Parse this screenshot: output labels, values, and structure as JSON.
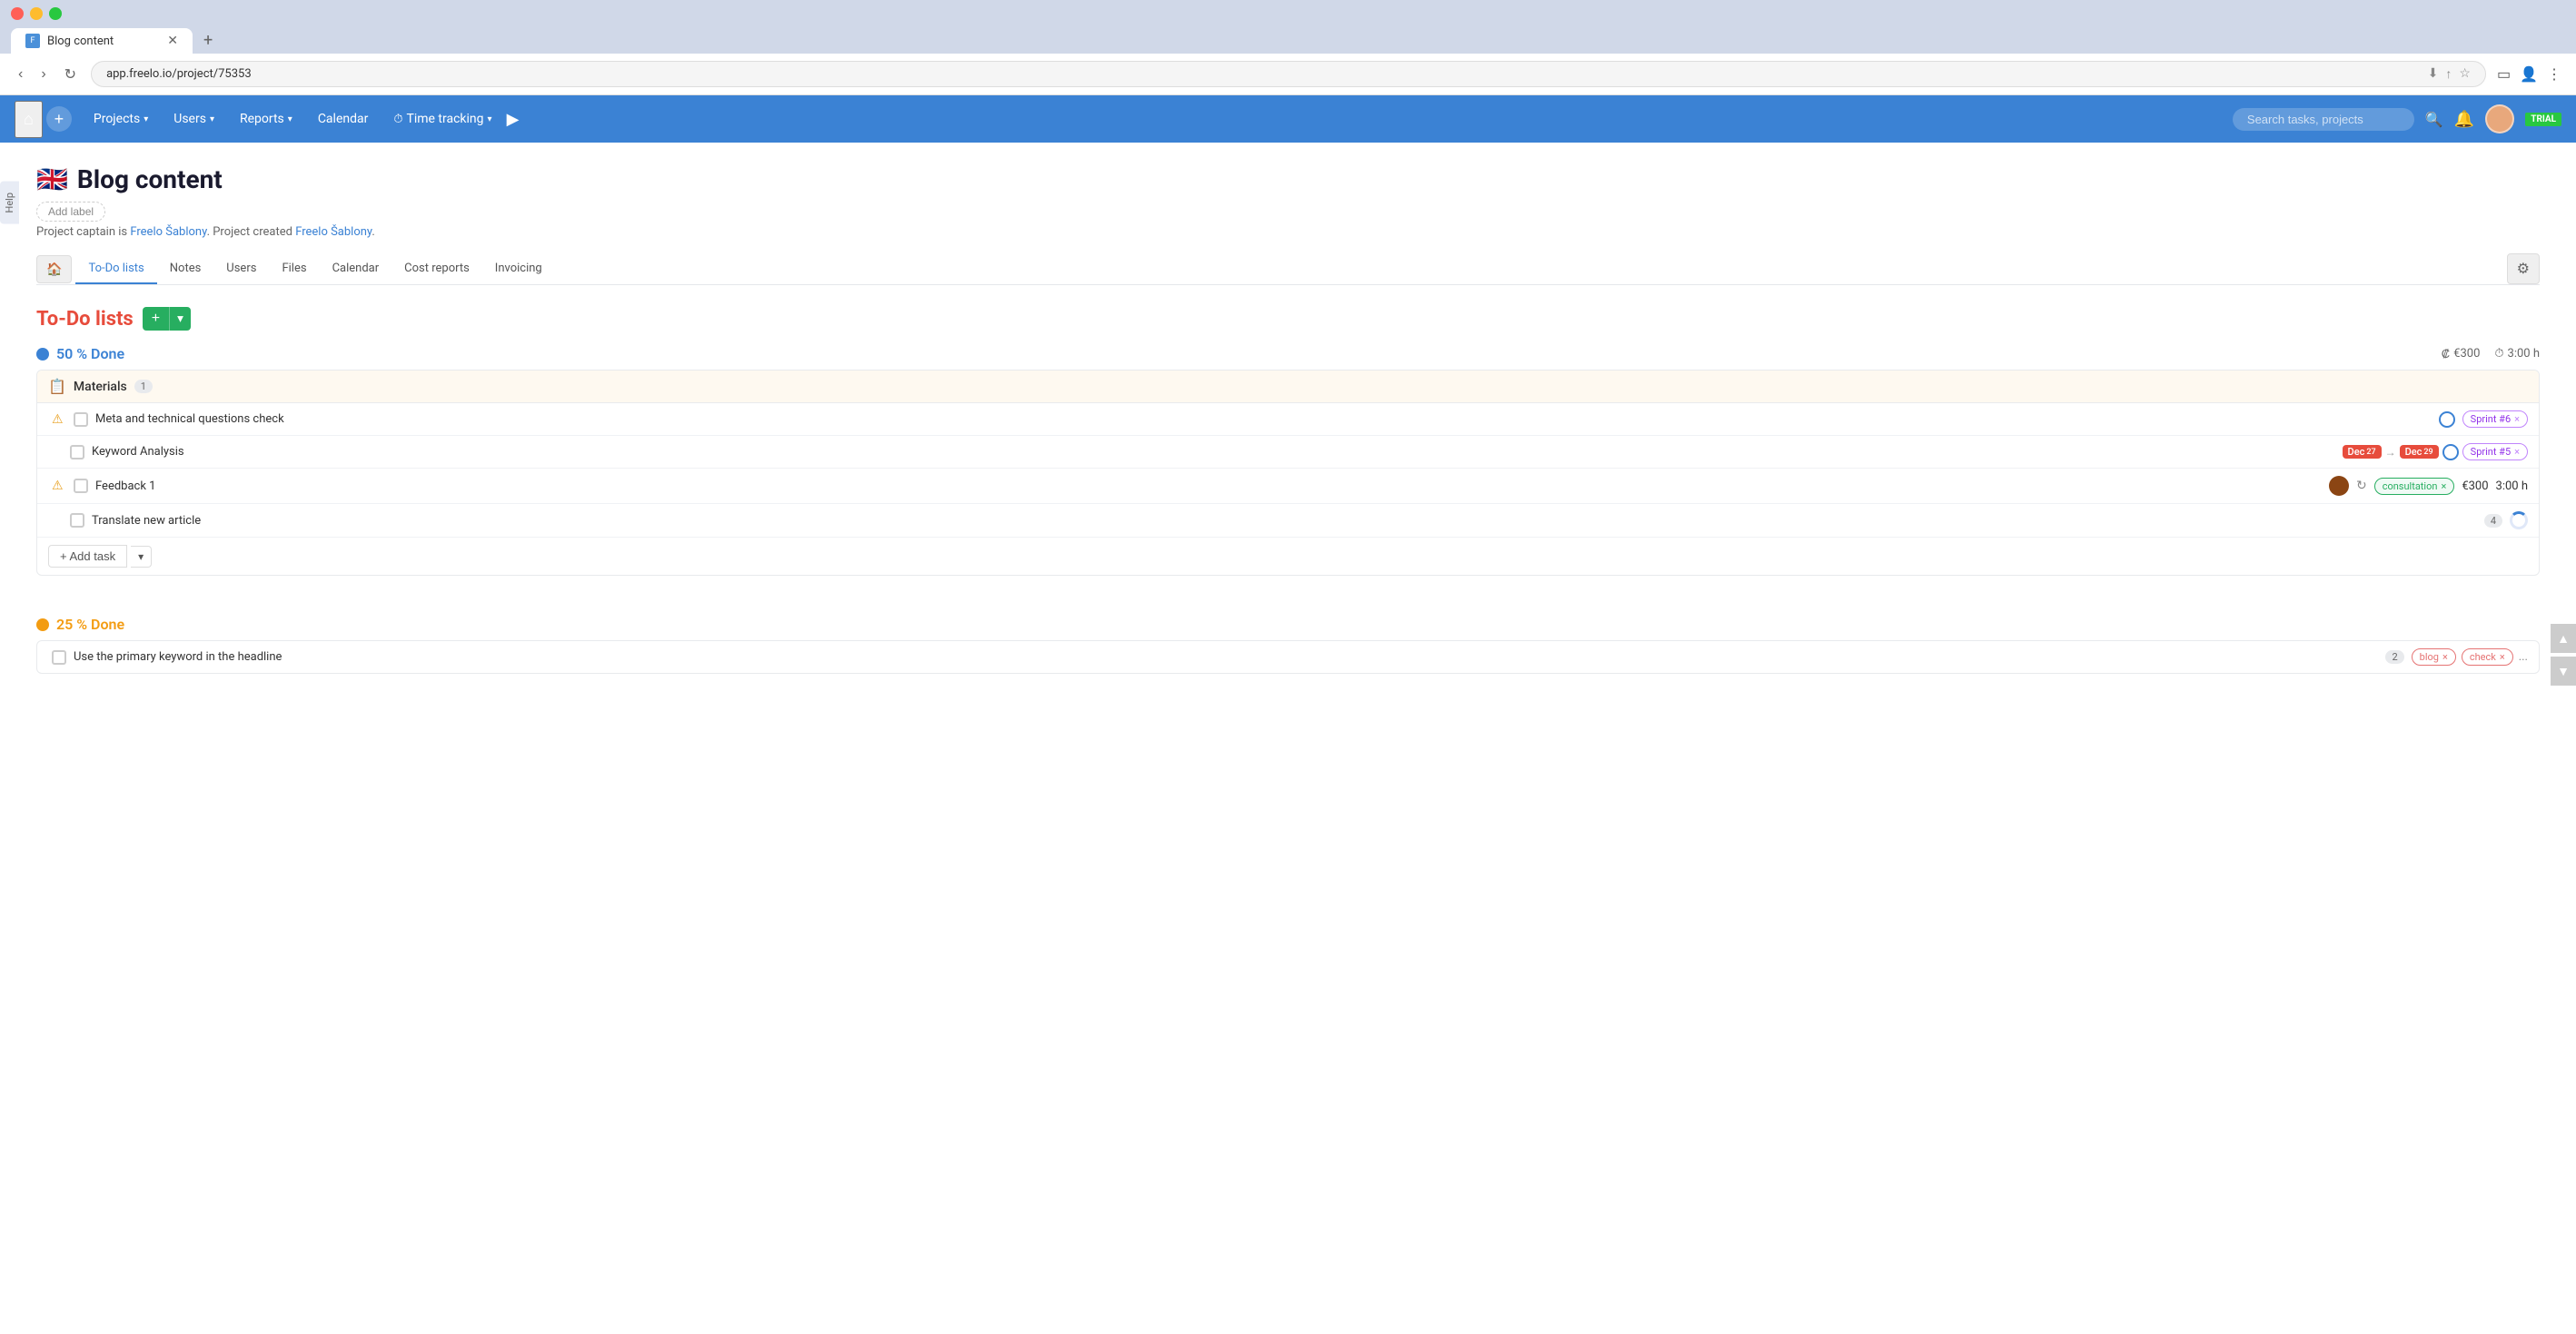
{
  "browser": {
    "url": "app.freelo.io/project/75353",
    "tab_title": "Blog content",
    "tab_icon": "F"
  },
  "nav": {
    "projects_label": "Projects",
    "users_label": "Users",
    "reports_label": "Reports",
    "calendar_label": "Calendar",
    "time_tracking_label": "Time tracking",
    "search_placeholder": "Search tasks, projects",
    "trial_label": "TRIAL"
  },
  "project": {
    "flag": "🇬🇧",
    "title": "Blog content",
    "add_label_btn": "Add label",
    "captain_text": "Project captain is",
    "captain_name": "Freelo Šablony",
    "created_text": ". Project created",
    "created_name": "Freelo Šablony",
    "captain_suffix": "."
  },
  "tabs": {
    "home": "🏠",
    "todo_lists": "To-Do lists",
    "notes": "Notes",
    "users": "Users",
    "files": "Files",
    "calendar": "Calendar",
    "cost_reports": "Cost reports",
    "invoicing": "Invoicing",
    "active": "To-Do lists"
  },
  "todo_section": {
    "title": "To-Do lists",
    "add_btn": "+",
    "add_dropdown": "▾"
  },
  "list1": {
    "dot_color": "#3b82d4",
    "progress": "50 % Done",
    "cost_icon": "₡",
    "cost": "€300",
    "time_icon": "⏱",
    "time": "3:00 h",
    "group_name": "Materials",
    "group_count": "1",
    "tasks": [
      {
        "name": "Meta and technical questions check",
        "indented": false,
        "warning": true,
        "sprint": "Sprint #6",
        "has_status_circle": true,
        "status_type": "outline"
      },
      {
        "name": "Keyword Analysis",
        "indented": true,
        "warning": false,
        "date_from": "Dec 27",
        "date_to": "Dec 29",
        "sprint": "Sprint #5",
        "has_status_circle": true,
        "status_type": "outline"
      },
      {
        "name": "Feedback 1",
        "indented": false,
        "warning": true,
        "tag": "consultation",
        "cost": "€300",
        "time": "3:00 h",
        "has_avatar": true,
        "has_repeat": true
      },
      {
        "name": "Translate new article",
        "indented": true,
        "warning": false,
        "count": "4",
        "has_status_circle": true,
        "status_type": "half"
      }
    ],
    "add_task_label": "+ Add task",
    "add_task_dropdown": "▾"
  },
  "list2": {
    "dot_color": "#f39c12",
    "progress": "25 % Done",
    "tasks": [
      {
        "name": "Use the primary keyword in the headline",
        "count": "2",
        "tags": [
          "blog",
          "check"
        ],
        "tag_more": "..."
      }
    ]
  },
  "help_label": "Help"
}
